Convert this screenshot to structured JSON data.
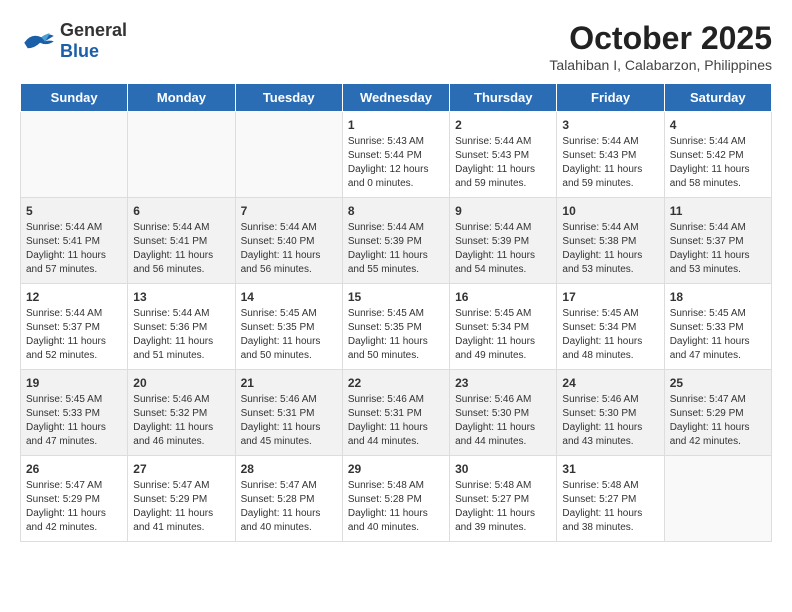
{
  "header": {
    "logo_general": "General",
    "logo_blue": "Blue",
    "month": "October 2025",
    "location": "Talahiban I, Calabarzon, Philippines"
  },
  "weekdays": [
    "Sunday",
    "Monday",
    "Tuesday",
    "Wednesday",
    "Thursday",
    "Friday",
    "Saturday"
  ],
  "weeks": [
    [
      {
        "day": "",
        "info": ""
      },
      {
        "day": "",
        "info": ""
      },
      {
        "day": "",
        "info": ""
      },
      {
        "day": "1",
        "info": "Sunrise: 5:43 AM\nSunset: 5:44 PM\nDaylight: 12 hours\nand 0 minutes."
      },
      {
        "day": "2",
        "info": "Sunrise: 5:44 AM\nSunset: 5:43 PM\nDaylight: 11 hours\nand 59 minutes."
      },
      {
        "day": "3",
        "info": "Sunrise: 5:44 AM\nSunset: 5:43 PM\nDaylight: 11 hours\nand 59 minutes."
      },
      {
        "day": "4",
        "info": "Sunrise: 5:44 AM\nSunset: 5:42 PM\nDaylight: 11 hours\nand 58 minutes."
      }
    ],
    [
      {
        "day": "5",
        "info": "Sunrise: 5:44 AM\nSunset: 5:41 PM\nDaylight: 11 hours\nand 57 minutes."
      },
      {
        "day": "6",
        "info": "Sunrise: 5:44 AM\nSunset: 5:41 PM\nDaylight: 11 hours\nand 56 minutes."
      },
      {
        "day": "7",
        "info": "Sunrise: 5:44 AM\nSunset: 5:40 PM\nDaylight: 11 hours\nand 56 minutes."
      },
      {
        "day": "8",
        "info": "Sunrise: 5:44 AM\nSunset: 5:39 PM\nDaylight: 11 hours\nand 55 minutes."
      },
      {
        "day": "9",
        "info": "Sunrise: 5:44 AM\nSunset: 5:39 PM\nDaylight: 11 hours\nand 54 minutes."
      },
      {
        "day": "10",
        "info": "Sunrise: 5:44 AM\nSunset: 5:38 PM\nDaylight: 11 hours\nand 53 minutes."
      },
      {
        "day": "11",
        "info": "Sunrise: 5:44 AM\nSunset: 5:37 PM\nDaylight: 11 hours\nand 53 minutes."
      }
    ],
    [
      {
        "day": "12",
        "info": "Sunrise: 5:44 AM\nSunset: 5:37 PM\nDaylight: 11 hours\nand 52 minutes."
      },
      {
        "day": "13",
        "info": "Sunrise: 5:44 AM\nSunset: 5:36 PM\nDaylight: 11 hours\nand 51 minutes."
      },
      {
        "day": "14",
        "info": "Sunrise: 5:45 AM\nSunset: 5:35 PM\nDaylight: 11 hours\nand 50 minutes."
      },
      {
        "day": "15",
        "info": "Sunrise: 5:45 AM\nSunset: 5:35 PM\nDaylight: 11 hours\nand 50 minutes."
      },
      {
        "day": "16",
        "info": "Sunrise: 5:45 AM\nSunset: 5:34 PM\nDaylight: 11 hours\nand 49 minutes."
      },
      {
        "day": "17",
        "info": "Sunrise: 5:45 AM\nSunset: 5:34 PM\nDaylight: 11 hours\nand 48 minutes."
      },
      {
        "day": "18",
        "info": "Sunrise: 5:45 AM\nSunset: 5:33 PM\nDaylight: 11 hours\nand 47 minutes."
      }
    ],
    [
      {
        "day": "19",
        "info": "Sunrise: 5:45 AM\nSunset: 5:33 PM\nDaylight: 11 hours\nand 47 minutes."
      },
      {
        "day": "20",
        "info": "Sunrise: 5:46 AM\nSunset: 5:32 PM\nDaylight: 11 hours\nand 46 minutes."
      },
      {
        "day": "21",
        "info": "Sunrise: 5:46 AM\nSunset: 5:31 PM\nDaylight: 11 hours\nand 45 minutes."
      },
      {
        "day": "22",
        "info": "Sunrise: 5:46 AM\nSunset: 5:31 PM\nDaylight: 11 hours\nand 44 minutes."
      },
      {
        "day": "23",
        "info": "Sunrise: 5:46 AM\nSunset: 5:30 PM\nDaylight: 11 hours\nand 44 minutes."
      },
      {
        "day": "24",
        "info": "Sunrise: 5:46 AM\nSunset: 5:30 PM\nDaylight: 11 hours\nand 43 minutes."
      },
      {
        "day": "25",
        "info": "Sunrise: 5:47 AM\nSunset: 5:29 PM\nDaylight: 11 hours\nand 42 minutes."
      }
    ],
    [
      {
        "day": "26",
        "info": "Sunrise: 5:47 AM\nSunset: 5:29 PM\nDaylight: 11 hours\nand 42 minutes."
      },
      {
        "day": "27",
        "info": "Sunrise: 5:47 AM\nSunset: 5:29 PM\nDaylight: 11 hours\nand 41 minutes."
      },
      {
        "day": "28",
        "info": "Sunrise: 5:47 AM\nSunset: 5:28 PM\nDaylight: 11 hours\nand 40 minutes."
      },
      {
        "day": "29",
        "info": "Sunrise: 5:48 AM\nSunset: 5:28 PM\nDaylight: 11 hours\nand 40 minutes."
      },
      {
        "day": "30",
        "info": "Sunrise: 5:48 AM\nSunset: 5:27 PM\nDaylight: 11 hours\nand 39 minutes."
      },
      {
        "day": "31",
        "info": "Sunrise: 5:48 AM\nSunset: 5:27 PM\nDaylight: 11 hours\nand 38 minutes."
      },
      {
        "day": "",
        "info": ""
      }
    ]
  ]
}
